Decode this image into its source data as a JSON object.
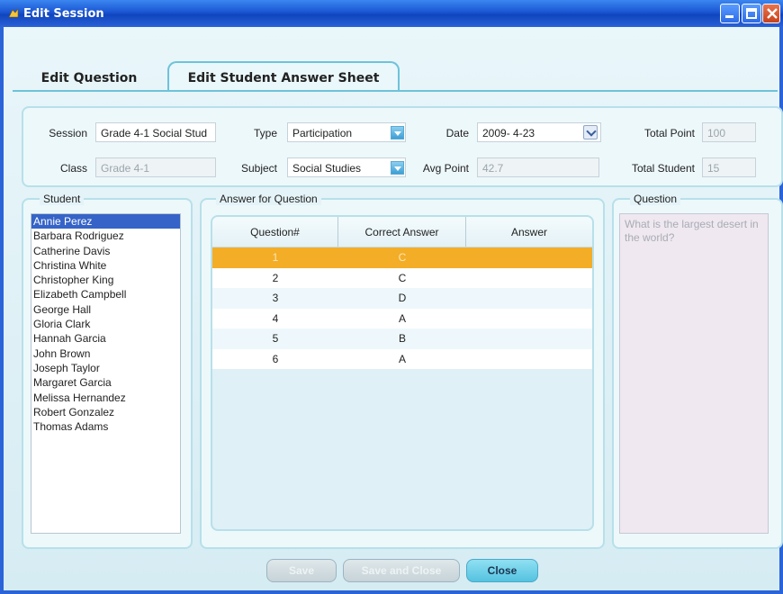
{
  "window": {
    "title": "Edit Session"
  },
  "tabs": [
    {
      "label": "Edit Question",
      "active": false
    },
    {
      "label": "Edit Student Answer Sheet",
      "active": true
    }
  ],
  "form": {
    "session_label": "Session",
    "session_value": "Grade 4-1 Social Stud",
    "type_label": "Type",
    "type_value": "Participation",
    "date_label": "Date",
    "date_value": "2009-  4-23",
    "total_point_label": "Total Point",
    "total_point_value": "100",
    "class_label": "Class",
    "class_value": "Grade 4-1",
    "subject_label": "Subject",
    "subject_value": "Social Studies",
    "avg_point_label": "Avg Point",
    "avg_point_value": "42.7",
    "total_student_label": "Total Student",
    "total_student_value": "15"
  },
  "student_panel": {
    "title": "Student",
    "students": [
      "Annie Perez",
      "Barbara Rodriguez",
      "Catherine Davis",
      "Christina White",
      "Christopher  King",
      "Elizabeth Campbell",
      "George Hall",
      "Gloria Clark",
      "Hannah Garcia",
      "John Brown",
      "Joseph Taylor",
      "Margaret Garcia",
      "Melissa Hernandez",
      "Robert Gonzalez",
      "Thomas Adams"
    ],
    "selected_index": 0
  },
  "answer_panel": {
    "title": "Answer for Question",
    "columns": [
      "Question#",
      "Correct Answer",
      "Answer"
    ],
    "rows": [
      {
        "q": "1",
        "correct": "C",
        "answer": ""
      },
      {
        "q": "2",
        "correct": "C",
        "answer": ""
      },
      {
        "q": "3",
        "correct": "D",
        "answer": ""
      },
      {
        "q": "4",
        "correct": "A",
        "answer": ""
      },
      {
        "q": "5",
        "correct": "B",
        "answer": ""
      },
      {
        "q": "6",
        "correct": "A",
        "answer": ""
      }
    ],
    "selected_index": 0
  },
  "question_panel": {
    "title": "Question",
    "text": "What is the largest desert in the world?"
  },
  "buttons": {
    "disabled1": "Save",
    "disabled2": "Save and Close",
    "close": "Close"
  },
  "colors": {
    "accent": "#6ec3d9",
    "title_bar": "#1a55d2",
    "selection": "#f4ad26",
    "list_selection": "#3563c7"
  }
}
